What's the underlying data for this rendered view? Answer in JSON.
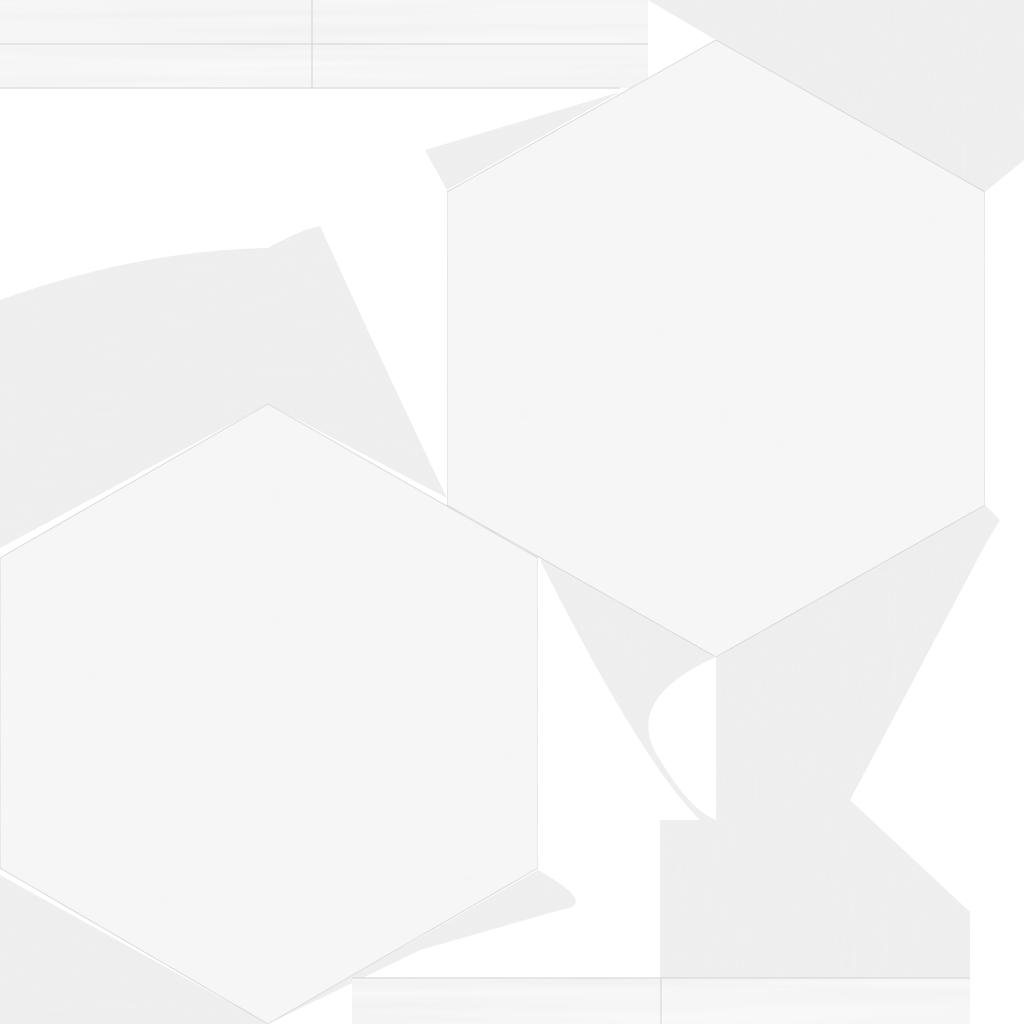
{
  "colors": {
    "background": "#ffffff",
    "panel_fill": "#f7f7f7",
    "panel_stroke": "#d2d2d2",
    "flare_base": "#efefef",
    "flare_light": "#fbfbfb",
    "flare_dark": "#e1e1e1",
    "speckle": "#e6e6e6"
  },
  "texture": {
    "panels": [
      {
        "name": "hexagon-panel-top-right",
        "shape": "hexagon"
      },
      {
        "name": "hexagon-panel-bottom-left",
        "shape": "hexagon"
      }
    ],
    "strips": [
      {
        "name": "seam-strip-top"
      },
      {
        "name": "seam-strip-bottom"
      }
    ]
  }
}
